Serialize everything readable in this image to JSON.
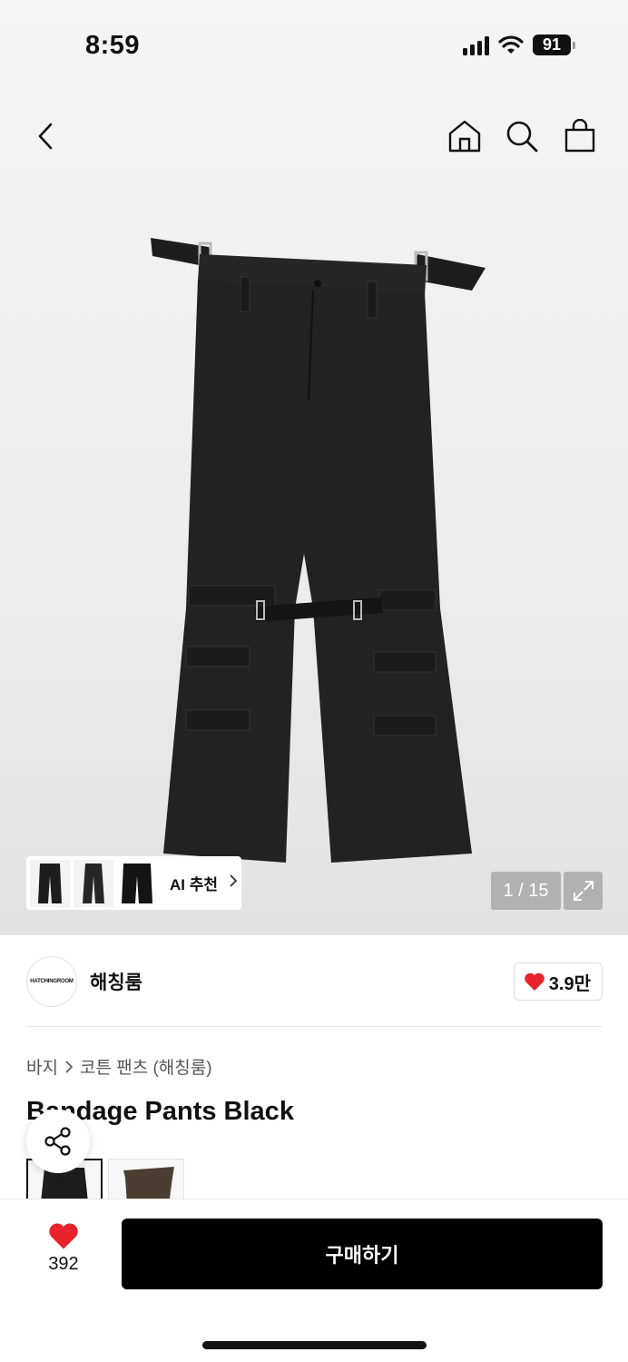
{
  "status": {
    "time": "8:59",
    "battery": "91"
  },
  "nav": {
    "back_icon": "chevron-left-icon",
    "home_icon": "home-icon",
    "search_icon": "search-icon",
    "cart_icon": "shopping-bag-icon"
  },
  "gallery": {
    "counter": "1 / 15",
    "ai_label": "AI 추천",
    "ai_chevron": "›"
  },
  "brand": {
    "logo_text": "HATCHINGROOM",
    "name": "해칭룸",
    "likes": "3.9만"
  },
  "breadcrumb": {
    "category": "바지",
    "subcategory": "코튼 팬츠 (해칭룸)"
  },
  "product": {
    "title": "Bandage Pants Black"
  },
  "bottom": {
    "wish_count": "392",
    "buy_label": "구매하기"
  },
  "colors": {
    "accent_heart": "#e8232b",
    "button_bg": "#000000"
  }
}
